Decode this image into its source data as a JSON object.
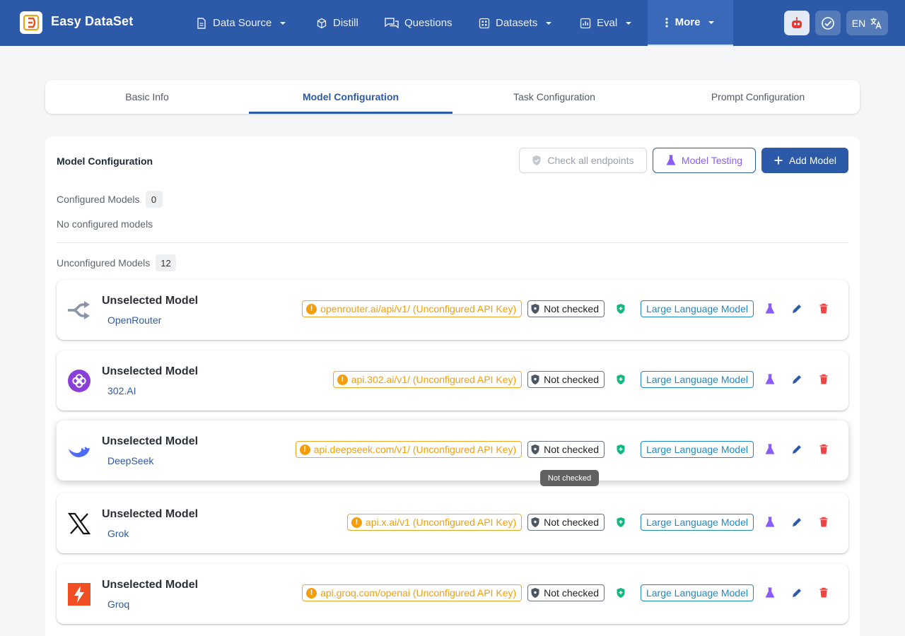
{
  "app": {
    "brand": "Easy DataSet"
  },
  "nav": [
    {
      "label": "Data Source",
      "icon": "file-icon",
      "dropdown": true
    },
    {
      "label": "Distill",
      "icon": "cube-icon",
      "dropdown": false
    },
    {
      "label": "Questions",
      "icon": "chat-icon",
      "dropdown": false
    },
    {
      "label": "Datasets",
      "icon": "grid-icon",
      "dropdown": true
    },
    {
      "label": "Eval",
      "icon": "bar-chart-icon",
      "dropdown": true
    },
    {
      "label": "More",
      "icon": "dots-vertical-icon",
      "dropdown": true,
      "active": true
    }
  ],
  "header_actions": {
    "language": "EN"
  },
  "tabs": [
    {
      "label": "Basic Info"
    },
    {
      "label": "Model Configuration",
      "active": true
    },
    {
      "label": "Task Configuration"
    },
    {
      "label": "Prompt Configuration"
    }
  ],
  "panel": {
    "title": "Model Configuration",
    "check_all_label": "Check all endpoints",
    "model_testing_label": "Model Testing",
    "add_model_label": "Add Model",
    "configured_label": "Configured Models",
    "configured_count": "0",
    "no_configured_text": "No configured models",
    "unconfigured_label": "Unconfigured Models",
    "unconfigured_count": "12"
  },
  "models": [
    {
      "name": "Unselected Model",
      "provider": "OpenRouter",
      "endpoint": "openrouter.ai/api/v1/ (Unconfigured API Key)",
      "status": "Not checked",
      "type": "Large Language Model",
      "icon": "openrouter-icon"
    },
    {
      "name": "Unselected Model",
      "provider": "302.AI",
      "endpoint": "api.302.ai/v1/ (Unconfigured API Key)",
      "status": "Not checked",
      "type": "Large Language Model",
      "icon": "302ai-icon"
    },
    {
      "name": "Unselected Model",
      "provider": "DeepSeek",
      "endpoint": "api.deepseek.com/v1/ (Unconfigured API Key)",
      "status": "Not checked",
      "type": "Large Language Model",
      "icon": "deepseek-icon"
    },
    {
      "name": "Unselected Model",
      "provider": "Grok",
      "endpoint": "api.x.ai/v1 (Unconfigured API Key)",
      "status": "Not checked",
      "type": "Large Language Model",
      "icon": "x-icon"
    },
    {
      "name": "Unselected Model",
      "provider": "Groq",
      "endpoint": "api.groq.com/openai (Unconfigured API Key)",
      "status": "Not checked",
      "type": "Large Language Model",
      "icon": "groq-icon"
    }
  ],
  "tooltip": {
    "text": "Not checked"
  },
  "colors": {
    "header": "#2c5aa8",
    "warning": "#f59e0b",
    "info": "#1e88c8",
    "success": "#10b981",
    "danger": "#ef4444",
    "purple": "#8b5cf6"
  }
}
